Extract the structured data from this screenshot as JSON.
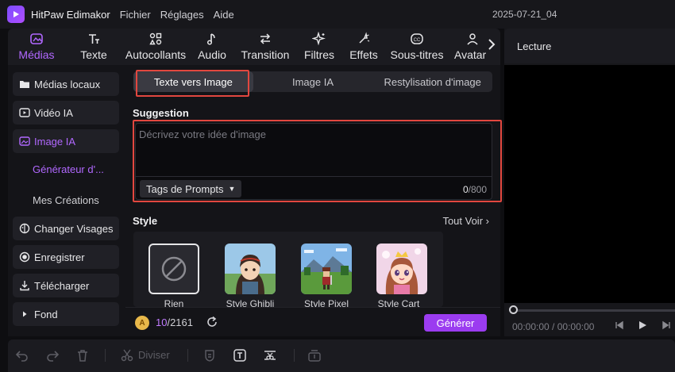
{
  "app": {
    "title": "HitPaw Edimakor",
    "menu": [
      "Fichier",
      "Réglages",
      "Aide"
    ],
    "project_name": "2025-07-21_04"
  },
  "toolbar": {
    "tabs": [
      {
        "label": "Médias",
        "icon": "media-icon",
        "active": true
      },
      {
        "label": "Texte",
        "icon": "text-icon",
        "active": false
      },
      {
        "label": "Autocollants",
        "icon": "stickers-icon",
        "active": false
      },
      {
        "label": "Audio",
        "icon": "music-note-icon",
        "active": false
      },
      {
        "label": "Transition",
        "icon": "transition-icon",
        "active": false
      },
      {
        "label": "Filtres",
        "icon": "sparkle-icon",
        "active": false
      },
      {
        "label": "Effets",
        "icon": "effects-icon",
        "active": false
      },
      {
        "label": "Sous-titres",
        "icon": "subtitles-icon",
        "active": false
      },
      {
        "label": "Avatar",
        "icon": "avatar-icon",
        "active": false
      }
    ]
  },
  "sidebar": {
    "items": [
      {
        "label": "Médias locaux",
        "icon": "folder-icon"
      },
      {
        "label": "Vidéo IA",
        "icon": "ai-video-icon"
      },
      {
        "label": "Image IA",
        "icon": "ai-image-icon",
        "active": true
      },
      {
        "label": "Changer Visages",
        "icon": "face-swap-icon"
      },
      {
        "label": "Enregistrer",
        "icon": "record-icon"
      },
      {
        "label": "Télécharger",
        "icon": "download-icon"
      },
      {
        "label": "Fond",
        "icon": "caret-right-icon"
      }
    ],
    "subitems": [
      {
        "label": "Générateur d'...",
        "active": true
      },
      {
        "label": "Mes Créations",
        "active": false
      }
    ]
  },
  "main": {
    "subtabs": [
      {
        "label": "Texte vers Image",
        "active": true
      },
      {
        "label": "Image IA",
        "active": false
      },
      {
        "label": "Restylisation d'image",
        "active": false
      }
    ],
    "prompt": {
      "section_title": "Suggestion",
      "placeholder": "Décrivez votre idée d'image",
      "value": "",
      "tags_label": "Tags de Prompts",
      "count": "0",
      "max": "/800"
    },
    "style": {
      "section_title": "Style",
      "see_all": "Tout Voir",
      "options": [
        {
          "label": "Rien",
          "selected": true
        },
        {
          "label": "Style Ghibli",
          "selected": false
        },
        {
          "label": "Style Pixel",
          "selected": false
        },
        {
          "label": "Style Cart",
          "selected": false
        }
      ]
    },
    "credits": {
      "current": "10",
      "total": "/2161"
    },
    "generate_label": "Générer"
  },
  "preview": {
    "title": "Lecture",
    "timecode_current": "00:00:00",
    "timecode_sep": " / ",
    "timecode_total": "00:00:00",
    "progress": 0
  },
  "timeline": {
    "split_label": "Diviser"
  },
  "colors": {
    "accent": "#b168ff",
    "generate_button": "#9b3cf0",
    "highlight_box": "#e2473f"
  }
}
